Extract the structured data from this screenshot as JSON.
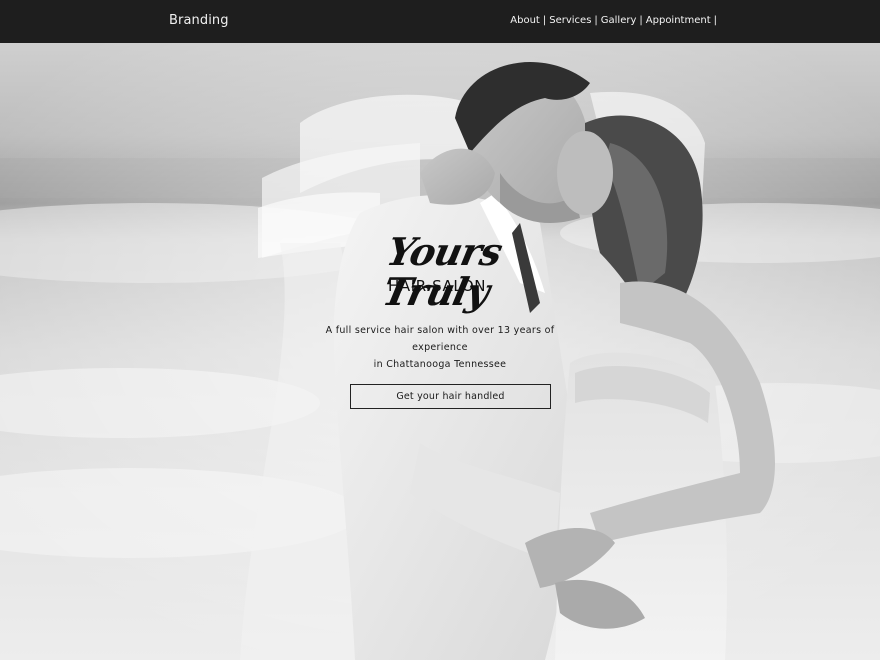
{
  "header": {
    "brand": "Branding",
    "nav": [
      {
        "label": "About"
      },
      {
        "label": "Services"
      },
      {
        "label": "Gallery"
      },
      {
        "label": "Appointment"
      }
    ],
    "separator": "|"
  },
  "hero": {
    "logo_script": "Yours Truly",
    "logo_sub": "HAIR SALON",
    "tagline_line1": "A full service hair salon with over 13 years of experience",
    "tagline_line2": "in Chattanooga Tennessee",
    "cta_label": "Get your hair handled",
    "image_desc_icon": "wedding-couple-photo"
  },
  "colors": {
    "navbar_bg": "#1e1e1e",
    "nav_text": "#f4f4f4",
    "text_dark": "#111111"
  }
}
